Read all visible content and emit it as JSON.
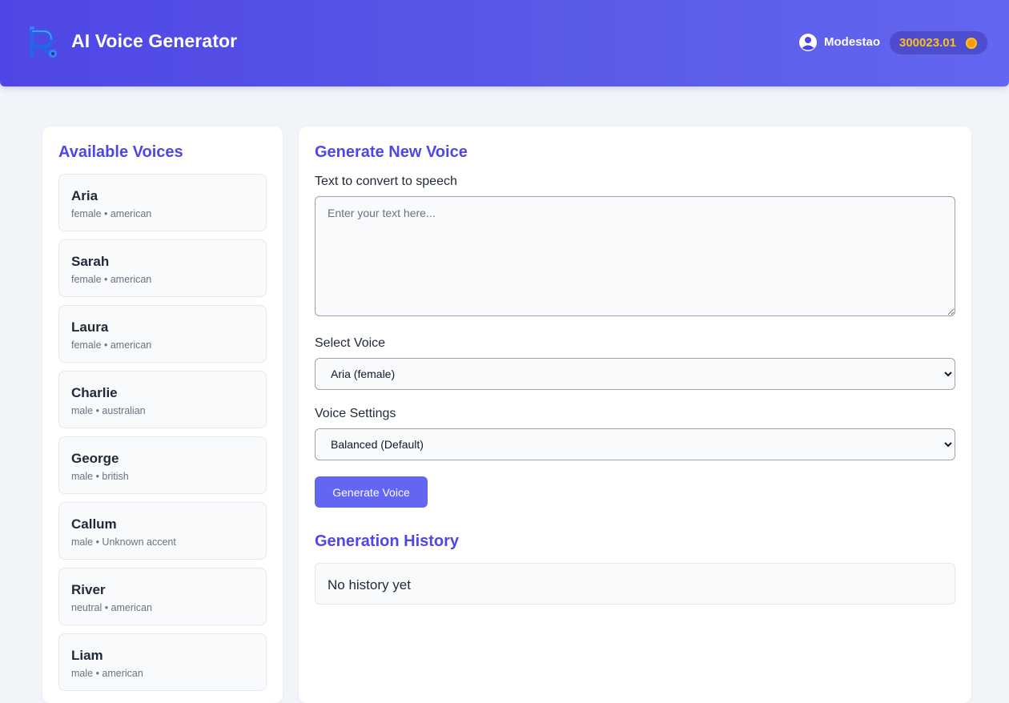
{
  "header": {
    "app_title": "AI Voice Generator",
    "logo_icon": "robot-r-logo-icon",
    "username": "Modestao",
    "user_icon": "user-circle-icon",
    "balance": "300023.01",
    "balance_icon": "coin-icon"
  },
  "voices": {
    "title": "Available Voices",
    "items": [
      {
        "name": "Aria",
        "meta": "female • american"
      },
      {
        "name": "Sarah",
        "meta": "female • american"
      },
      {
        "name": "Laura",
        "meta": "female • american"
      },
      {
        "name": "Charlie",
        "meta": "male • australian"
      },
      {
        "name": "George",
        "meta": "male • british"
      },
      {
        "name": "Callum",
        "meta": "male • Unknown accent"
      },
      {
        "name": "River",
        "meta": "neutral • american"
      },
      {
        "name": "Liam",
        "meta": "male • american"
      }
    ]
  },
  "generator": {
    "title": "Generate New Voice",
    "text_label": "Text to convert to speech",
    "text_placeholder": "Enter your text here...",
    "text_value": "",
    "voice_label": "Select Voice",
    "voice_selected": "Aria (female)",
    "settings_label": "Voice Settings",
    "settings_selected": "Balanced (Default)",
    "generate_button": "Generate Voice"
  },
  "history": {
    "title": "Generation History",
    "empty_text": "No history yet"
  },
  "colors": {
    "header_gradient_start": "#4f46e5",
    "header_gradient_end": "#6366f1",
    "accent": "#4f46e5",
    "button": "#6366f1",
    "balance_text": "#fbbf24",
    "page_background": "#f1f4f8"
  }
}
